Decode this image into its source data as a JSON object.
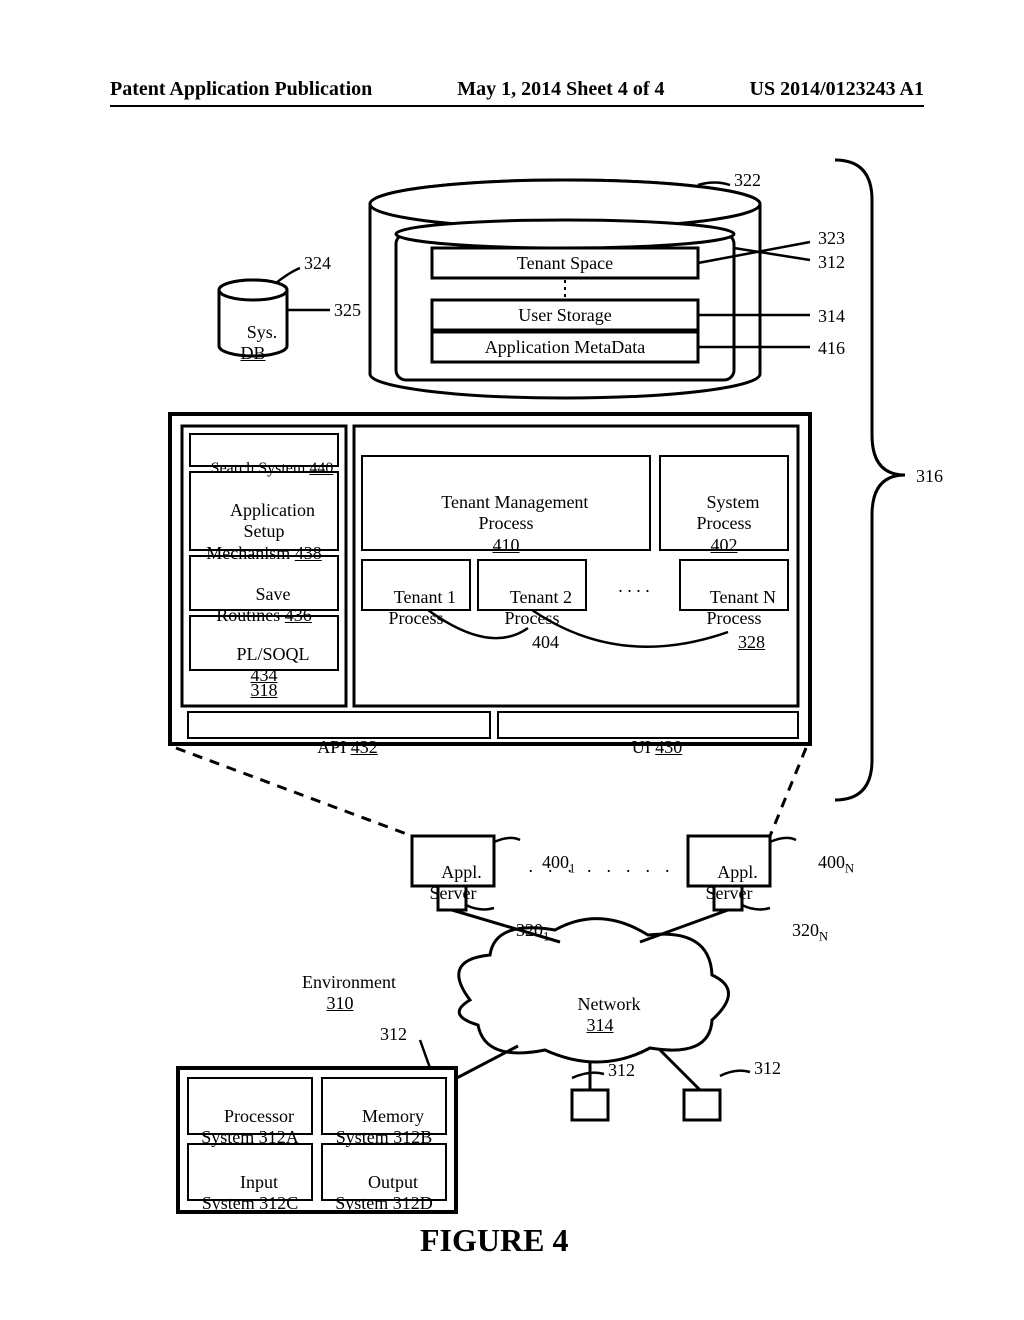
{
  "header": {
    "left": "Patent Application Publication",
    "center": "May 1, 2014  Sheet 4 of 4",
    "right": "US 2014/0123243 A1"
  },
  "figure_caption": "FIGURE 4",
  "system_ref": "316",
  "db": {
    "sys_db": {
      "line1": "Sys.",
      "line2": "DB",
      "ref": "324",
      "ref2": "325"
    },
    "main_ref": "322",
    "tenant_space": {
      "label": "Tenant Space",
      "ref": "323"
    },
    "inner_ref": "312",
    "user_storage": {
      "label": "User Storage",
      "ref": "314"
    },
    "app_metadata": {
      "label": "Application MetaData",
      "ref": "416"
    }
  },
  "panel": {
    "search_system": {
      "label": "Search System",
      "num": "440"
    },
    "app_setup": {
      "l1": "Application",
      "l2": "Setup",
      "l3": "Mechanism",
      "num": "438"
    },
    "save_routines": {
      "l1": "Save",
      "l2": "Routines",
      "num": "436"
    },
    "plsoql": {
      "l1": "PL/SOQL",
      "num": "434"
    },
    "col_ref": "318",
    "tmp": {
      "l1": "Tenant Management",
      "l2": "Process",
      "num": "410"
    },
    "sysproc": {
      "l1": "System",
      "l2": "Process",
      "num": "402"
    },
    "t1": {
      "l1": "Tenant 1",
      "l2": "Process"
    },
    "t2": {
      "l1": "Tenant 2",
      "l2": "Process"
    },
    "tn": {
      "l1": "Tenant N",
      "l2": "Process"
    },
    "t_dots": ". . . .",
    "t_ref_404": "404",
    "t_ref_328": "328",
    "api": {
      "label": "API",
      "num": "432"
    },
    "ui": {
      "label": "UI",
      "num": "430"
    }
  },
  "servers": {
    "appl": "Appl.",
    "server": "Server",
    "s1_ref": "400",
    "s1_sub": "1",
    "sn_ref": "400",
    "sn_sub": "N",
    "dots": ".  .  .  .  .  .  .  .",
    "port1_ref": "320",
    "port1_sub": "1",
    "portn_ref": "320",
    "portn_sub": "N"
  },
  "env": {
    "l1": "Environment",
    "num": "310"
  },
  "network": {
    "l1": "Network",
    "num": "314"
  },
  "client": {
    "ref": "312",
    "proc": {
      "l1": "Processor",
      "l2": "System",
      "num": "312A"
    },
    "mem": {
      "l1": "Memory",
      "l2": "System",
      "num": "312B"
    },
    "in": {
      "l1": "Input",
      "l2": "System",
      "num": "312C"
    },
    "out": {
      "l1": "Output",
      "l2": "System",
      "num": "312D"
    }
  },
  "small_boxes": {
    "ref_left": "312",
    "ref_right": "312"
  }
}
